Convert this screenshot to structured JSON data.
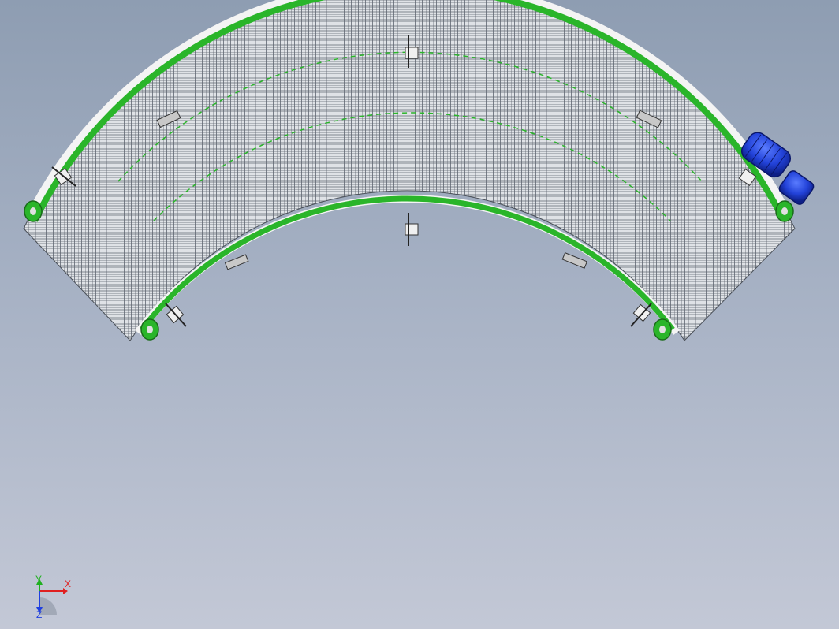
{
  "viewport": {
    "background_top": "#8e9db2",
    "background_bottom": "#c3c8d6"
  },
  "model": {
    "belt_color": "#2ab52a",
    "mesh_color": "#6f7780",
    "frame_color": "#e8e8e8",
    "motor_color": "#2244dd",
    "components": [
      "curved-belt-conveyor",
      "drive-motor",
      "gearbox",
      "end-rollers",
      "side-guide-brackets"
    ]
  },
  "triad": {
    "x_label": "X",
    "y_label": "Y",
    "z_label": "Z",
    "x_color": "#e02020",
    "y_color": "#20b020",
    "z_color": "#2040e0"
  }
}
